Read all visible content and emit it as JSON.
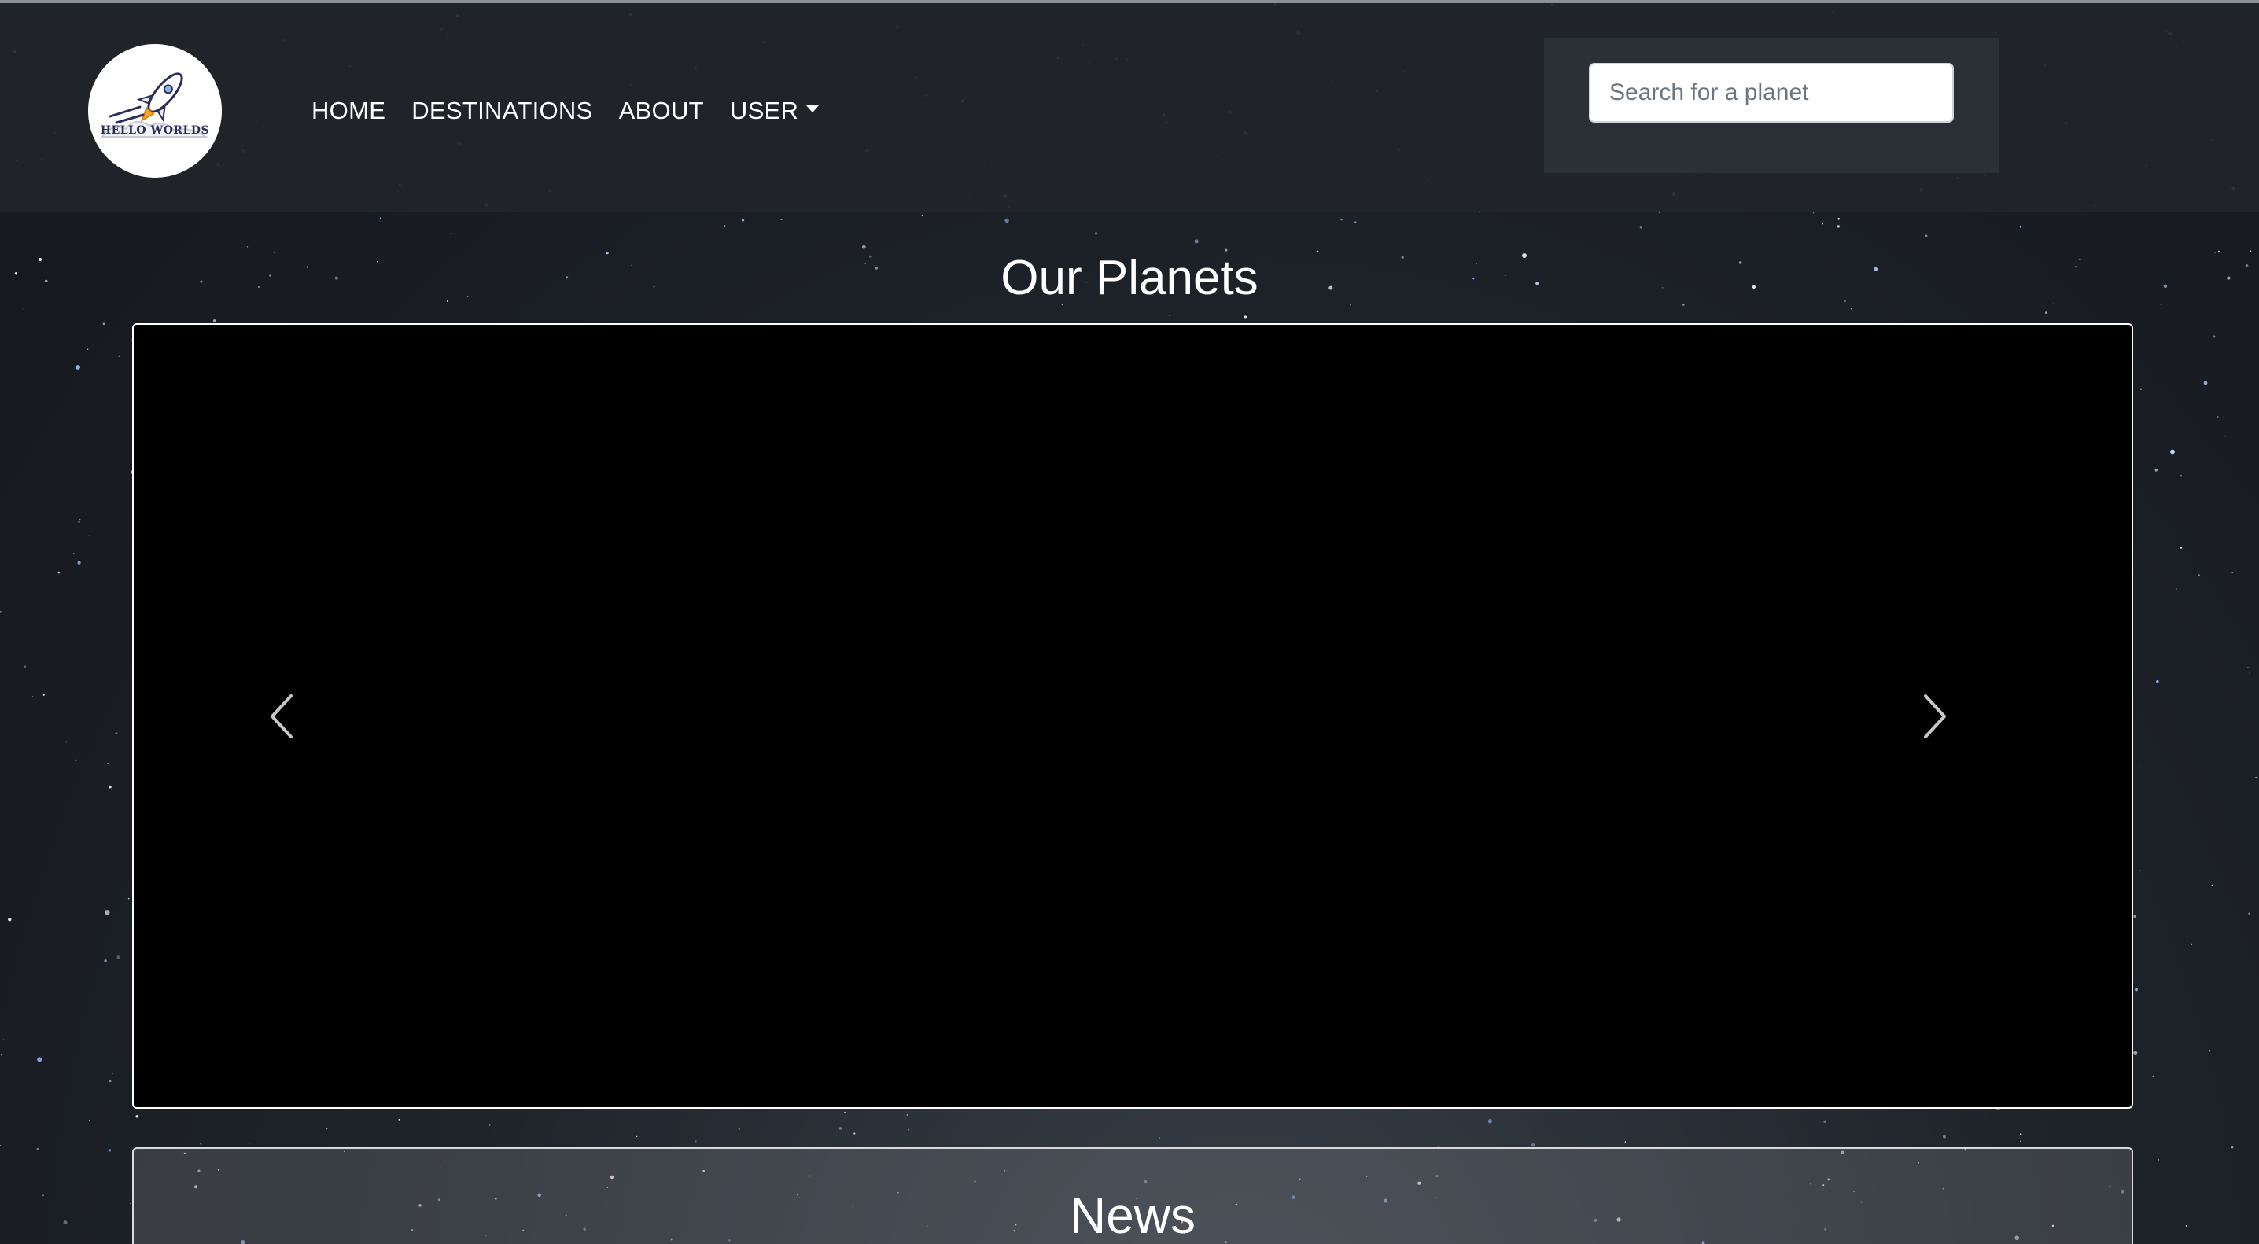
{
  "navbar": {
    "logo_text": "HELLO WORLDS",
    "links": [
      {
        "label": "HOME"
      },
      {
        "label": "DESTINATIONS"
      },
      {
        "label": "ABOUT"
      },
      {
        "label": "USER"
      }
    ],
    "user_dropdown_icon": "caret-down-icon"
  },
  "search": {
    "placeholder": "Search for a planet",
    "value": ""
  },
  "planets_section": {
    "title": "Our Planets",
    "carousel": {
      "prev_icon": "chevron-left-icon",
      "next_icon": "chevron-right-icon"
    }
  },
  "news_section": {
    "title": "News"
  },
  "colors": {
    "navbar_bg": "#212529",
    "search_panel_bg": "#2b3036",
    "carousel_bg": "#000000",
    "text": "#ffffff"
  }
}
